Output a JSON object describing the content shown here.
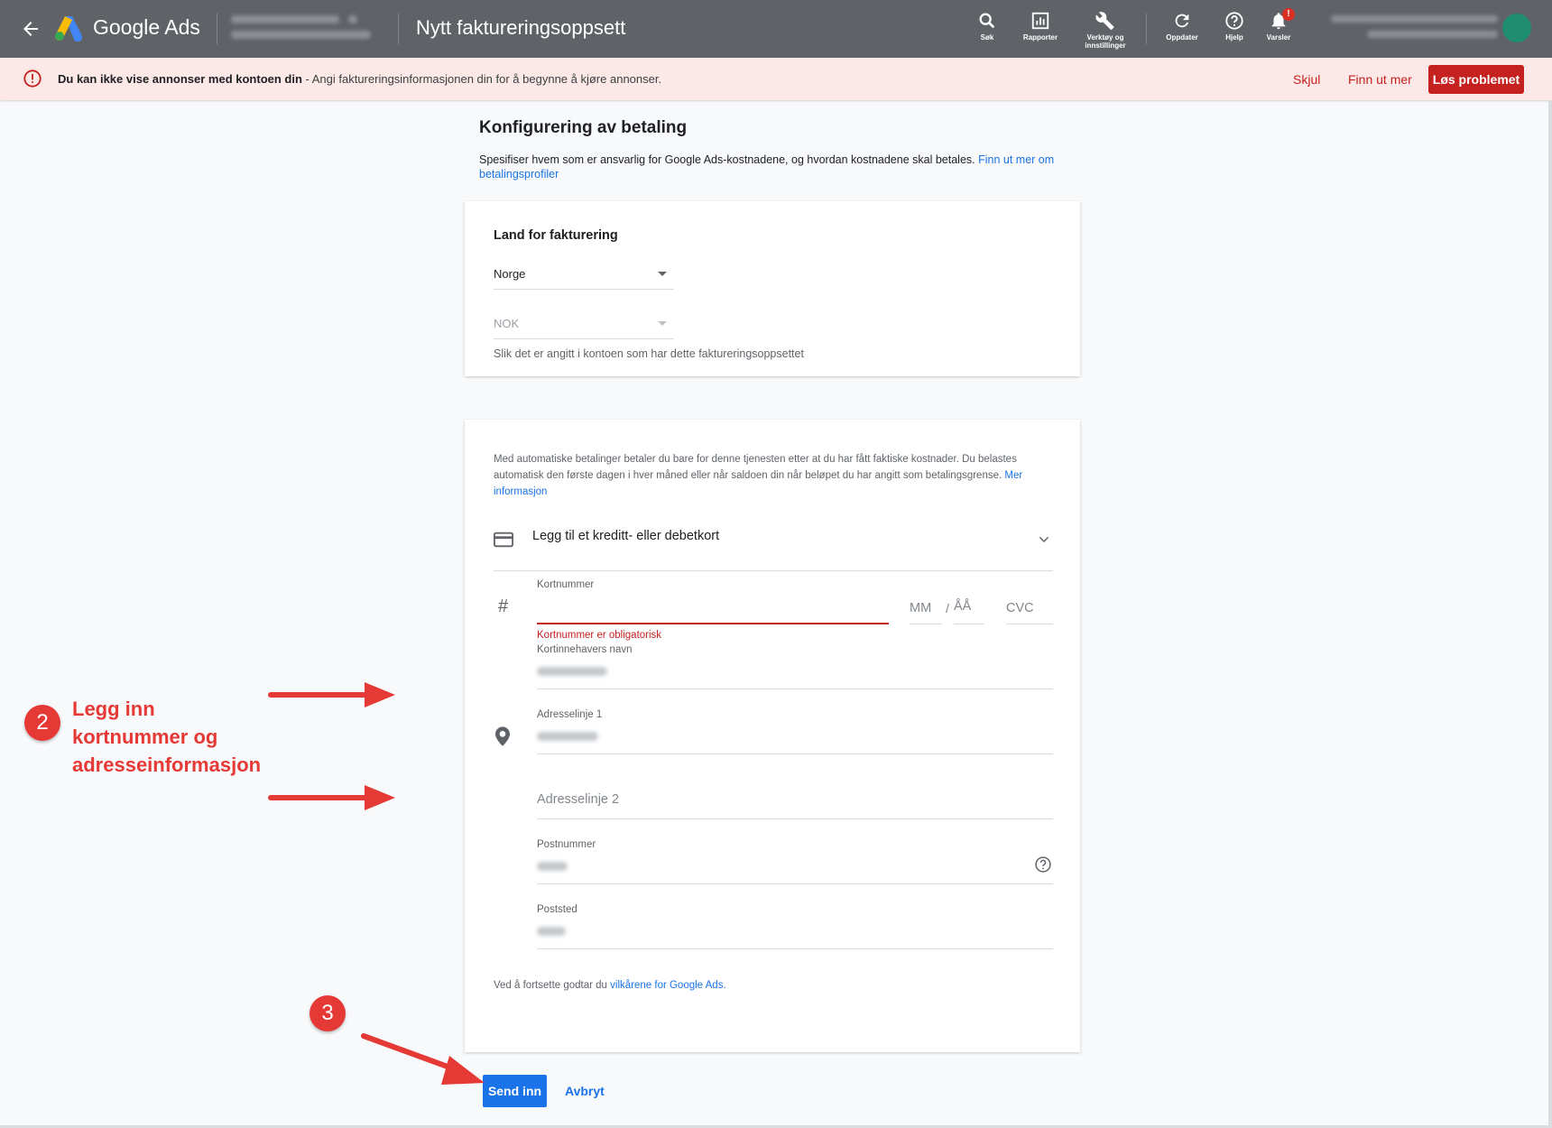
{
  "header": {
    "product_name": "Google Ads",
    "page_title": "Nytt faktureringsoppsett",
    "tools": [
      {
        "icon": "search-icon",
        "label": "Søk"
      },
      {
        "icon": "reports-icon",
        "label": "Rapporter"
      },
      {
        "icon": "wrench-icon",
        "label": "Verktøy og innstillinger"
      },
      {
        "icon": "refresh-icon",
        "label": "Oppdater"
      },
      {
        "icon": "help-icon",
        "label": "Hjelp"
      },
      {
        "icon": "bell-icon",
        "label": "Varsler"
      }
    ],
    "notification_badge": "!"
  },
  "banner": {
    "bold_text": "Du kan ikke vise annonser med kontoen din",
    "text": " - Angi faktureringsinformasjonen din for å begynne å kjøre annonser.",
    "hide_label": "Skjul",
    "learn_more_label": "Finn ut mer",
    "fix_label": "Løs problemet"
  },
  "setup": {
    "title": "Konfigurering av betaling",
    "description": "Spesifiser hvem som er ansvarlig for Google Ads-kostnadene, og hvordan kostnadene skal betales.",
    "description_link": "Finn ut mer om betalingsprofiler"
  },
  "billing_country": {
    "heading": "Land for fakturering",
    "country_value": "Norge",
    "currency_value": "NOK",
    "hint": "Slik det er angitt i kontoen som har dette faktureringsoppsettet"
  },
  "payment": {
    "info_text": "Med automatiske betalinger betaler du bare for denne tjenesten etter at du har fått faktiske kostnader. Du belastes automatisk den første dagen i hver måned eller når saldoen din når beløpet du har angitt som betalingsgrense.",
    "info_link": "Mer informasjon",
    "add_card_label": "Legg til et kreditt- eller debetkort",
    "card_number_label": "Kortnummer",
    "card_number_error": "Kortnummer er obligatorisk",
    "month_placeholder": "MM",
    "year_placeholder": "ÅÅ",
    "cvc_placeholder": "CVC",
    "cardholder_label": "Kortinnehavers navn",
    "address1_label": "Adresselinje 1",
    "address2_placeholder": "Adresselinje 2",
    "postal_code_label": "Postnummer",
    "city_label": "Poststed",
    "terms_text": "Ved å fortsette godtar du",
    "terms_link": "vilkårene for Google Ads."
  },
  "actions": {
    "submit_label": "Send inn",
    "cancel_label": "Avbryt"
  },
  "annotations": {
    "step2_number": "2",
    "step2_lines": [
      "Legg inn",
      "kortnummer og",
      "adresseinformasjon"
    ],
    "step3_number": "3",
    "color": "#e53935"
  },
  "colors": {
    "header_bg": "#5f6368",
    "banner_bg": "#fce8e6",
    "error_red": "#c5221f",
    "primary_blue": "#1a73e8"
  }
}
